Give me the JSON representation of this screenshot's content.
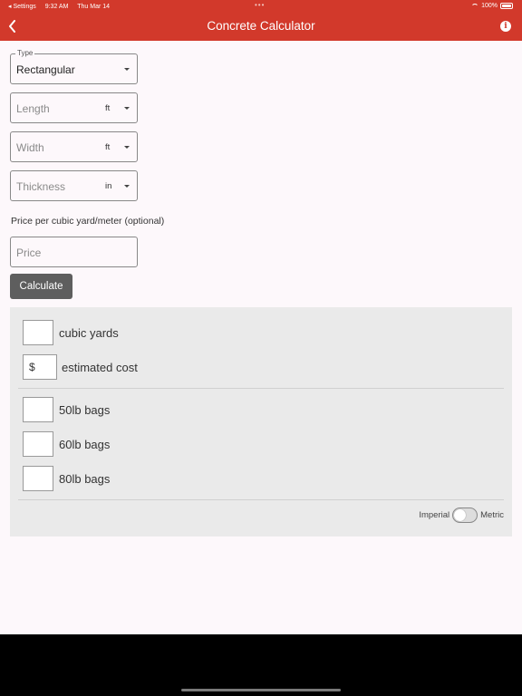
{
  "status_bar": {
    "back_app": "◂ Settings",
    "time": "9:32 AM",
    "date": "Thu Mar 14",
    "dots": "•••",
    "battery": "100%"
  },
  "header": {
    "title": "Concrete Calculator"
  },
  "form": {
    "type": {
      "label": "Type",
      "value": "Rectangular"
    },
    "length": {
      "placeholder": "Length",
      "unit": "ft"
    },
    "width": {
      "placeholder": "Width",
      "unit": "ft"
    },
    "thickness": {
      "placeholder": "Thickness",
      "unit": "in"
    },
    "price_label": "Price per cubic yard/meter (optional)",
    "price": {
      "placeholder": "Price"
    },
    "calculate_label": "Calculate"
  },
  "results": {
    "volume_label": "cubic yards",
    "cost_prefix": "$",
    "cost_label": "estimated cost",
    "bags": [
      {
        "label": "50lb bags"
      },
      {
        "label": "60lb bags"
      },
      {
        "label": "80lb bags"
      }
    ],
    "toggle": {
      "left_label": "Imperial",
      "right_label": "Metric",
      "metric_on": false
    }
  },
  "colors": {
    "accent": "#d2392b",
    "button": "#5e5e5e",
    "panel": "#eaeaea"
  }
}
